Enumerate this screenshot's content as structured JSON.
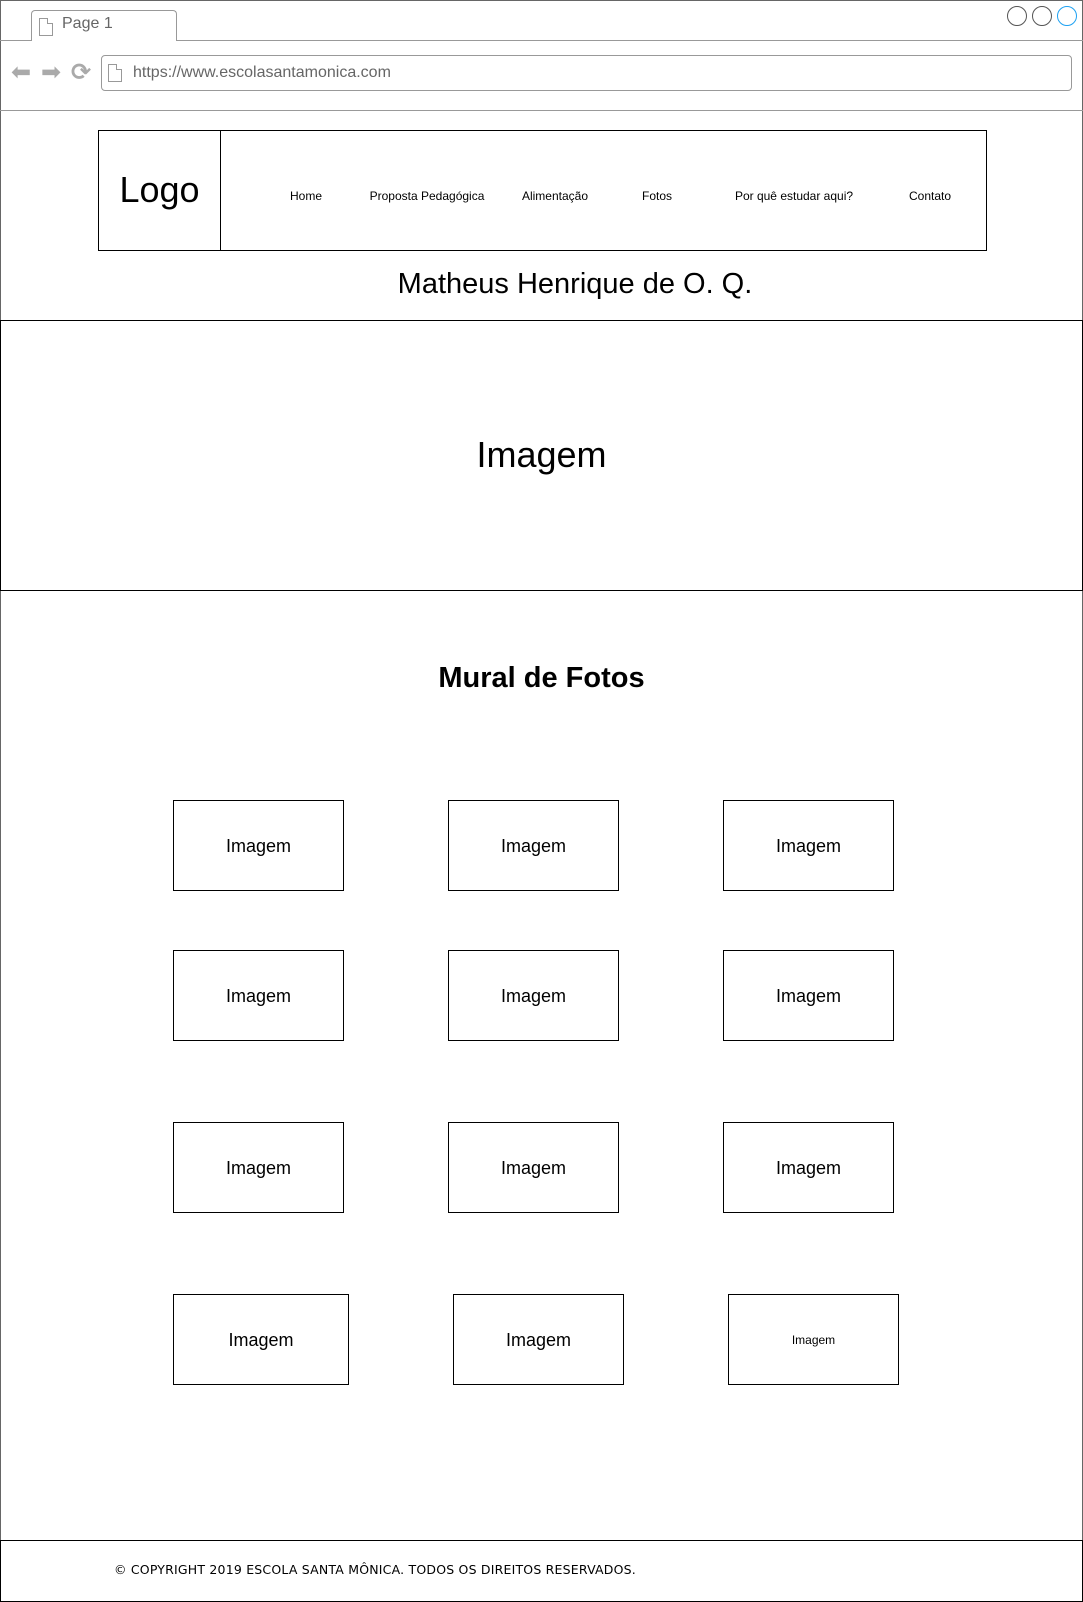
{
  "browser": {
    "tab_label": "Page 1",
    "url": "https://www.escolasantamonica.com"
  },
  "header": {
    "logo": "Logo",
    "menu": [
      "Home",
      "Proposta Pedagógica",
      "Alimentação",
      "Fotos",
      "Por quê estudar aqui?",
      "Contato"
    ],
    "author": "Matheus Henrique de O. Q."
  },
  "hero": {
    "label": "Imagem"
  },
  "gallery": {
    "title": "Mural de Fotos",
    "photos": [
      "Imagem",
      "Imagem",
      "Imagem",
      "Imagem",
      "Imagem",
      "Imagem",
      "Imagem",
      "Imagem",
      "Imagem",
      "Imagem",
      "Imagem",
      "Imagem"
    ]
  },
  "footer": {
    "copyright": "© COPYRIGHT 2019 ESCOLA SANTA MÔNICA. TODOS OS DIREITOS RESERVADOS."
  }
}
